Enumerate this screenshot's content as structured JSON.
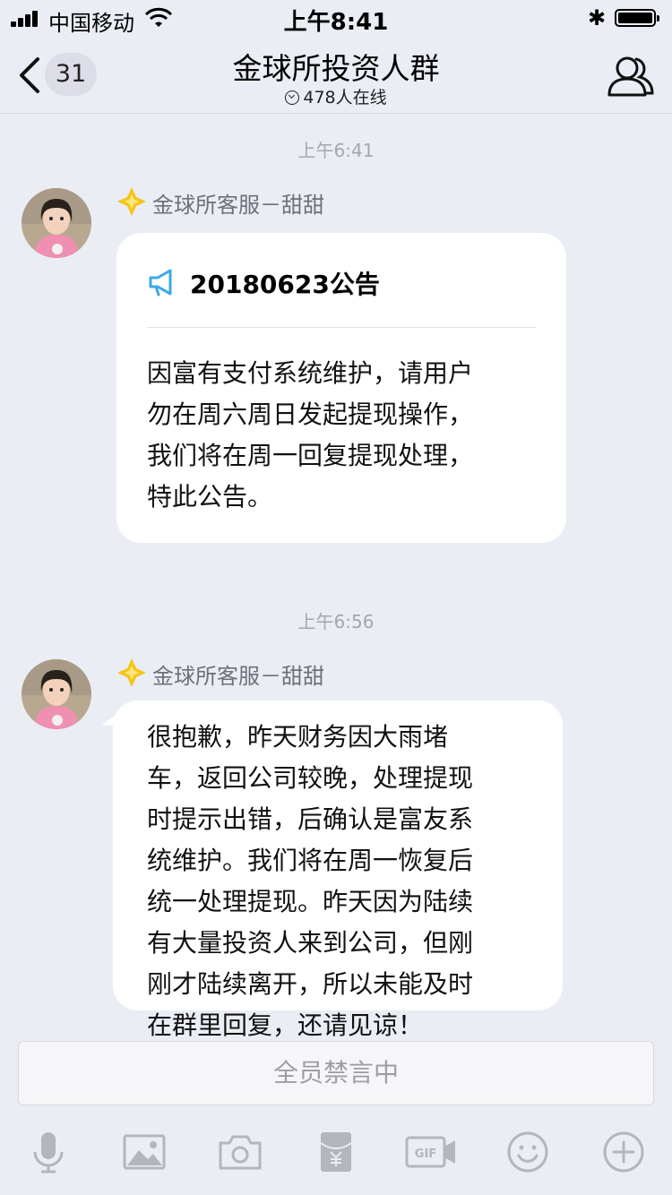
{
  "status_bar": {
    "carrier": "中国移动",
    "time": "上午8:41"
  },
  "nav": {
    "back_count": "31",
    "title": "金球所投资人群",
    "online": "478人在线"
  },
  "messages": [
    {
      "timestamp": "上午6:41",
      "sender": "金球所客服－甜甜",
      "notice_title": "20180623公告",
      "text": "因富有支付系统维护，请用户勿在周六周日发起提现操作，我们将在周一回复提现处理，特此公告。",
      "lines": [
        "因富有支付系统维护，请用户",
        "勿在周六周日发起提现操作，",
        "我们将在周一回复提现处理，",
        "特此公告。"
      ]
    },
    {
      "timestamp": "上午6:56",
      "sender": "金球所客服－甜甜",
      "text": "很抱歉，昨天财务因大雨堵车，返回公司较晚，处理提现时提示出错，后确认是富友系统维护。我们将在周一恢复后统一处理提现。昨天因为陆续有大量投资人来到公司，但刚刚才陆续离开，所以未能及时在群里回复，还请见谅！",
      "lines": [
        "很抱歉，昨天财务因大雨堵",
        "车，返回公司较晚，处理提现",
        "时提示出错，后确认是富友系",
        "统维护。我们将在周一恢复后",
        "统一处理提现。昨天因为陆续",
        "有大量投资人来到公司，但刚",
        "刚才陆续离开，所以未能及时",
        "在群里回复，还请见谅！"
      ]
    }
  ],
  "input": {
    "muted_text": "全员禁言中"
  },
  "toolbar_icons": [
    "microphone-icon",
    "image-icon",
    "camera-icon",
    "red-packet-icon",
    "gif-icon",
    "emoji-icon",
    "plus-icon"
  ],
  "colors": {
    "background": "#ebedf5",
    "bubble": "#ffffff",
    "muted_text": "#9c9ea6",
    "notice_icon": "#3aa9e6",
    "badge": "#f5c518"
  }
}
